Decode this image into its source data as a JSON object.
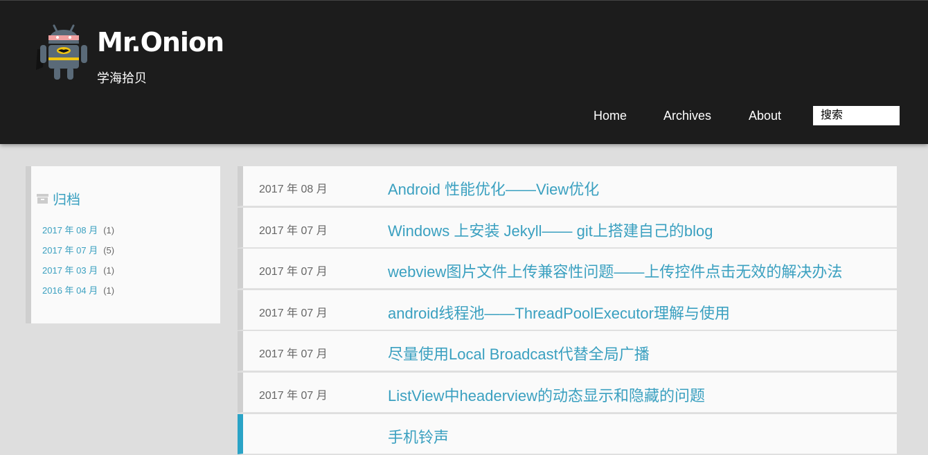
{
  "header": {
    "title": "Mr.Onion",
    "subtitle": "学海拾贝",
    "nav": [
      "Home",
      "Archives",
      "About"
    ],
    "search_placeholder": "搜索"
  },
  "sidebar": {
    "title": "归档",
    "archives": [
      {
        "month": "2017 年 08 月",
        "count": "(1)"
      },
      {
        "month": "2017 年 07 月",
        "count": "(5)"
      },
      {
        "month": "2017 年 03 月",
        "count": "(1)"
      },
      {
        "month": "2016 年 04 月",
        "count": "(1)"
      }
    ]
  },
  "posts": [
    {
      "date": "2017 年 08 月",
      "title": "Android 性能优化——View优化"
    },
    {
      "date": "2017 年 07 月",
      "title": "Windows 上安装 Jekyll—— git上搭建自己的blog"
    },
    {
      "date": "2017 年 07 月",
      "title": "webview图片文件上传兼容性问题——上传控件点击无效的解决办法"
    },
    {
      "date": "2017 年 07 月",
      "title": "android线程池——ThreadPoolExecutor理解与使用"
    },
    {
      "date": "2017 年 07 月",
      "title": "尽量使用Local Broadcast代替全局广播"
    },
    {
      "date": "2017 年 07 月",
      "title": "ListView中headerview的动态显示和隐藏的问题"
    },
    {
      "date": "",
      "title": "手机铃声"
    }
  ],
  "colors": {
    "header_bg": "#1c1c1c",
    "page_bg": "#dedede",
    "link": "#3aa0c0",
    "active_bar": "#2aa3c6"
  }
}
